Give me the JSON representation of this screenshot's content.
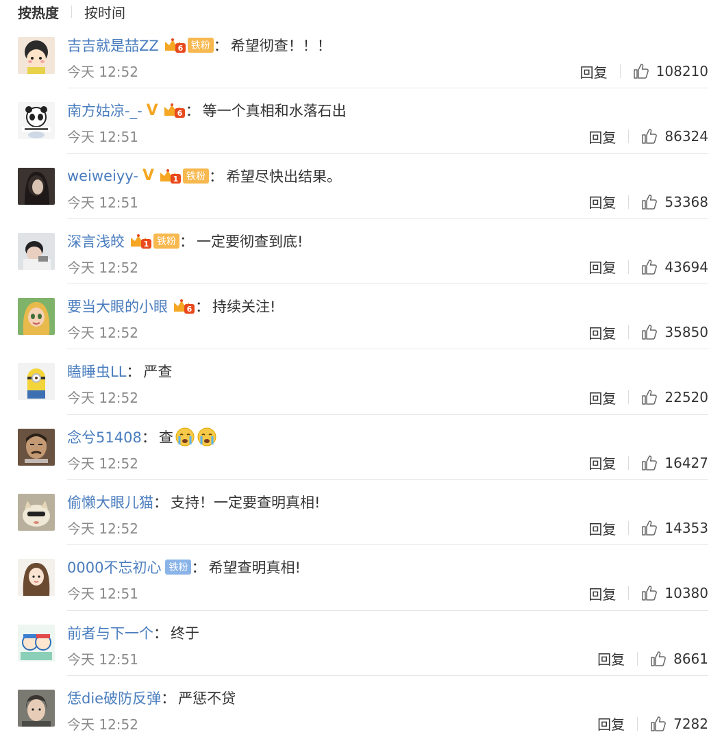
{
  "sort": {
    "active": "按热度",
    "other": "按时间"
  },
  "reply_label": "回复",
  "comments": [
    {
      "user": "吉吉就是喆ZZ",
      "v": false,
      "crown": "6",
      "tiefen": true,
      "tiefen_style": "gold",
      "text": "希望彻查！！！",
      "time": "今天 12:52",
      "likes": "108210",
      "avatar": "cartoon-girl"
    },
    {
      "user": "南方姑凉-_-",
      "v": true,
      "crown": "6",
      "tiefen": false,
      "text": "等一个真相和水落石出",
      "time": "今天 12:51",
      "likes": "86324",
      "avatar": "panda"
    },
    {
      "user": "weiweiyy-",
      "v": true,
      "crown": "1",
      "tiefen": true,
      "tiefen_style": "gold",
      "text": "希望尽快出结果。",
      "time": "今天 12:51",
      "likes": "53368",
      "avatar": "dark-hair"
    },
    {
      "user": "深言浅皎",
      "v": false,
      "crown": "1",
      "tiefen": true,
      "tiefen_style": "gold",
      "text": "一定要彻查到底!",
      "time": "今天 12:52",
      "likes": "43694",
      "avatar": "boy"
    },
    {
      "user": "要当大眼的小眼",
      "v": false,
      "crown": "6",
      "tiefen": false,
      "text": "持续关注!",
      "time": "今天 12:52",
      "likes": "35850",
      "avatar": "princess"
    },
    {
      "user": "瞌睡虫LL",
      "v": false,
      "crown": "",
      "tiefen": false,
      "text": "严查",
      "time": "今天 12:52",
      "likes": "22520",
      "avatar": "minion"
    },
    {
      "user": "念兮51408",
      "v": false,
      "crown": "",
      "tiefen": false,
      "text": "查",
      "emojis": 2,
      "time": "今天 12:52",
      "likes": "16427",
      "avatar": "man-face"
    },
    {
      "user": "偷懒大眼儿猫",
      "v": false,
      "crown": "",
      "tiefen": false,
      "text": "支持！一定要查明真相!",
      "time": "今天 12:52",
      "likes": "14353",
      "avatar": "cat"
    },
    {
      "user": "0000不忘初心",
      "v": false,
      "crown": "",
      "tiefen": true,
      "tiefen_style": "blue",
      "text": "希望查明真相!",
      "time": "今天 12:51",
      "likes": "10380",
      "avatar": "long-hair"
    },
    {
      "user": "前者与下一个",
      "v": false,
      "crown": "",
      "tiefen": false,
      "text": "终于",
      "time": "今天 12:51",
      "likes": "8661",
      "avatar": "cartoon-kids"
    },
    {
      "user": "恁die破防反弹",
      "v": false,
      "crown": "",
      "tiefen": false,
      "text": "严惩不贷",
      "time": "今天 12:52",
      "likes": "7282",
      "avatar": "actor"
    }
  ],
  "tiefen_label": "铁粉",
  "v_glyph": "V"
}
